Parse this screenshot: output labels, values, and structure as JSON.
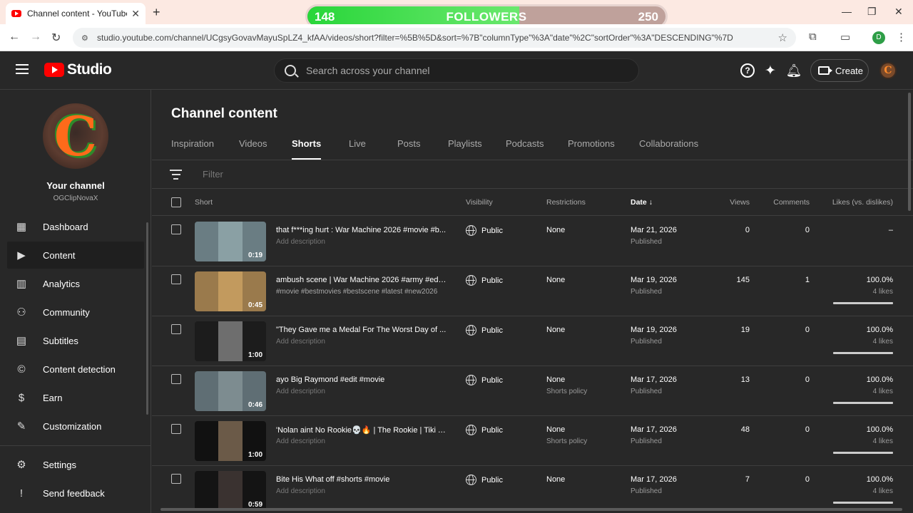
{
  "browser": {
    "tab_title": "Channel content - YouTube Studio",
    "new_tab": "+",
    "url": "studio.youtube.com/channel/UCgsyGovavMayuSpLZ4_kfAA/videos/short?filter=%5B%5D&sort=%7B\"columnType\"%3A\"date\"%2C\"sortOrder\"%3A\"DESCENDING\"%7D",
    "profile_initial": "D"
  },
  "followers_overlay": {
    "label": "FOLLOWERS",
    "current": "148",
    "goal": "250",
    "progress_fraction": 0.592,
    "fill_color": "#29d63a"
  },
  "header": {
    "logo_text": "Studio",
    "search_placeholder": "Search across your channel",
    "create_label": "Create",
    "avatar_letter": "C"
  },
  "sidebar": {
    "channel_label": "Your channel",
    "channel_handle": "OGClipNovaX",
    "avatar_letter": "C",
    "items": [
      {
        "label": "Dashboard",
        "icon": "dashboard-icon"
      },
      {
        "label": "Content",
        "icon": "content-icon",
        "active": true
      },
      {
        "label": "Analytics",
        "icon": "analytics-icon"
      },
      {
        "label": "Community",
        "icon": "community-icon"
      },
      {
        "label": "Subtitles",
        "icon": "subtitles-icon"
      },
      {
        "label": "Content detection",
        "icon": "copyright-icon"
      },
      {
        "label": "Earn",
        "icon": "earn-icon"
      },
      {
        "label": "Customization",
        "icon": "customization-icon"
      }
    ],
    "bottom_items": [
      {
        "label": "Settings",
        "icon": "settings-icon"
      },
      {
        "label": "Send feedback",
        "icon": "feedback-icon"
      }
    ]
  },
  "main": {
    "title": "Channel content",
    "tabs": [
      "Inspiration",
      "Videos",
      "Shorts",
      "Live",
      "Posts",
      "Playlists",
      "Podcasts",
      "Promotions",
      "Collaborations"
    ],
    "active_tab": "Shorts",
    "filter_placeholder": "Filter",
    "columns": {
      "short": "Short",
      "visibility": "Visibility",
      "restrictions": "Restrictions",
      "date": "Date",
      "views": "Views",
      "comments": "Comments",
      "likes": "Likes (vs. dislikes)"
    },
    "rows": [
      {
        "title": "that f***ing hurt : War Machine 2026 #movie #b...",
        "desc": "Add description",
        "duration": "0:19",
        "visibility": "Public",
        "restriction": "None",
        "restriction_sub": "",
        "date": "Mar 21, 2026",
        "status": "Published",
        "views": "0",
        "comments": "0",
        "likes": "–",
        "likes_sub": "",
        "thumb_bg": "#6a7d83",
        "frame_bg": "#8aa0a4"
      },
      {
        "title": "ambush scene | War Machine 2026 #army #edit...",
        "desc": "#movie #bestmovies #bestscene #latest #new2026",
        "duration": "0:45",
        "visibility": "Public",
        "restriction": "None",
        "restriction_sub": "",
        "date": "Mar 19, 2026",
        "status": "Published",
        "views": "145",
        "comments": "1",
        "likes": "100.0%",
        "likes_sub": "4 likes",
        "thumb_bg": "#9a7a4c",
        "frame_bg": "#c29a5e"
      },
      {
        "title": "\"They Gave me a Medal For The Worst Day of ...",
        "desc": "Add description",
        "duration": "1:00",
        "visibility": "Public",
        "restriction": "None",
        "restriction_sub": "",
        "date": "Mar 19, 2026",
        "status": "Published",
        "views": "19",
        "comments": "0",
        "likes": "100.0%",
        "likes_sub": "4 likes",
        "thumb_bg": "#1c1c1c",
        "frame_bg": "#6e6e6e"
      },
      {
        "title": "ayo Big Raymond #edit #movie",
        "desc": "Add description",
        "duration": "0:46",
        "visibility": "Public",
        "restriction": "None",
        "restriction_sub": "Shorts policy",
        "date": "Mar 17, 2026",
        "status": "Published",
        "views": "13",
        "comments": "0",
        "likes": "100.0%",
        "likes_sub": "4 likes",
        "thumb_bg": "#5f6e74",
        "frame_bg": "#7d8c90"
      },
      {
        "title": "'Nolan aint No Rookie💀🔥 | The Rookie | Tiki Ti...",
        "desc": "Add description",
        "duration": "1:00",
        "visibility": "Public",
        "restriction": "None",
        "restriction_sub": "Shorts policy",
        "date": "Mar 17, 2026",
        "status": "Published",
        "views": "48",
        "comments": "0",
        "likes": "100.0%",
        "likes_sub": "4 likes",
        "thumb_bg": "#111111",
        "frame_bg": "#6b5a48"
      },
      {
        "title": "Bite His What off #shorts #movie",
        "desc": "Add description",
        "duration": "0:59",
        "visibility": "Public",
        "restriction": "None",
        "restriction_sub": "",
        "date": "Mar 17, 2026",
        "status": "Published",
        "views": "7",
        "comments": "0",
        "likes": "100.0%",
        "likes_sub": "4 likes",
        "thumb_bg": "#141414",
        "frame_bg": "#3a3230"
      }
    ]
  }
}
